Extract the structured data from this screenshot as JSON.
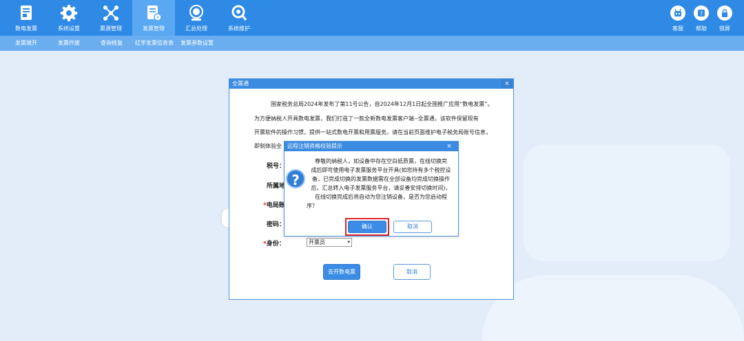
{
  "nav": {
    "items": [
      {
        "label": "数电发票",
        "icon": "invoice-document-icon"
      },
      {
        "label": "系统设置",
        "icon": "gear-icon"
      },
      {
        "label": "票源管理",
        "icon": "network-icon"
      },
      {
        "label": "发票管理",
        "icon": "invoice-manage-icon"
      },
      {
        "label": "汇总处理",
        "icon": "tax-stamp-icon"
      },
      {
        "label": "系统维护",
        "icon": "maintenance-search-icon"
      }
    ],
    "active_index": 3,
    "right_tools": [
      {
        "label": "客服",
        "icon": "robot-icon"
      },
      {
        "label": "帮助",
        "icon": "help-icon"
      },
      {
        "label": "锁屏",
        "icon": "lock-icon"
      }
    ]
  },
  "subnav": {
    "items": [
      "发票填开",
      "发票作废",
      "查询修复",
      "红字发票信息表",
      "发票参数设置"
    ]
  },
  "dialog": {
    "title": "全票通",
    "close": "×",
    "notice_lines": [
      "国家税务总局2024年发布了第11号公告，自2024年12月1日起全国推广应用“数电发票”。",
      "为方便纳税人开具数电发票，我们打造了一款全新数电发票客户端--全票通，该软件保留现有",
      "开票软件的操作习惯，提供一站式数电开票和用票服务。请在当前页面维护电子税务局账号信息，",
      "即刻体验全"
    ],
    "fields": {
      "tax_no_label": "税号：",
      "region_label": "所属地",
      "account_label": "电局账",
      "password_label": "密码：",
      "role_label": "身份：",
      "role_value": "开票员",
      "required_mark": "*"
    },
    "go_button": "去开数电票",
    "cancel_button": "取消"
  },
  "confirm": {
    "title": "远程注销资格校验提示",
    "close": "×",
    "lines": [
      "尊敬的纳税人，如设备中存在空白纸质票，在线切换完",
      "成后即可使用电子发票服务平台开具(如您持有多个税控设",
      "备，已完成切换的发票数据需在全部设备均完成切换操作",
      "后，汇总转入电子发票服务平台，请妥善安排切换时间)，",
      "在线切换完成后将自动为您注销设备，是否为您启动程",
      "序？"
    ],
    "confirm_button": "确认",
    "cancel_button": "取消",
    "icon_glyph": "?"
  },
  "colors": {
    "topbar": "#2f8ae6",
    "subbar": "#6aaef0",
    "highlight": "#d9232b"
  }
}
